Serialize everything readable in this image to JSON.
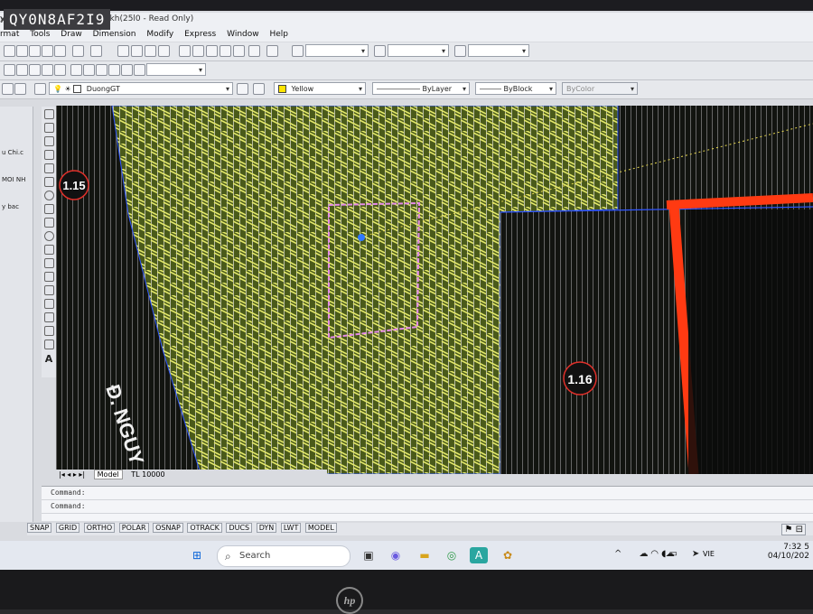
{
  "watermark": "QY0N8AF2I9",
  "window": {
    "title": "y hoach(,c qh 1-2000( 36c kh(25l0 - Read Only)",
    "close_icon": "x"
  },
  "menu": [
    "rmat",
    "Tools",
    "Draw",
    "Dimension",
    "Modify",
    "Express",
    "Window",
    "Help"
  ],
  "toolbar": {
    "layer_name": "DuongGT",
    "color_value": "Yellow",
    "linetype_value": "ByLayer",
    "lineweight_value": "ByBlock",
    "plotstyle_value": "ByColor"
  },
  "palette_items": [
    "u Chi.c",
    "MOI NH",
    "y bac"
  ],
  "canvas": {
    "labels": [
      "1.15",
      "1.16"
    ],
    "street_text": "Đ. NGUY"
  },
  "tabs": {
    "model": "Model",
    "layout": "TL 10000"
  },
  "command_lines": [
    "Command:",
    "Command:"
  ],
  "status_buttons": [
    "SNAP",
    "GRID",
    "ORTHO",
    "POLAR",
    "OSNAP",
    "OTRACK",
    "DUCS",
    "DYN",
    "LWT",
    "MODEL"
  ],
  "taskbar": {
    "search_placeholder": "Search",
    "language": "VIE",
    "time": "7:32 5",
    "date": "04/10/202"
  },
  "laptop_logo": "hp",
  "colors": {
    "hatch_green": "#4a5a1a",
    "hatch_yellow": "#d8e060",
    "red_boundary": "#ff3a12",
    "label_circle": "#e0302a",
    "blue_boundary": "#2f55ff",
    "magenta_rect": "#e58be8"
  }
}
